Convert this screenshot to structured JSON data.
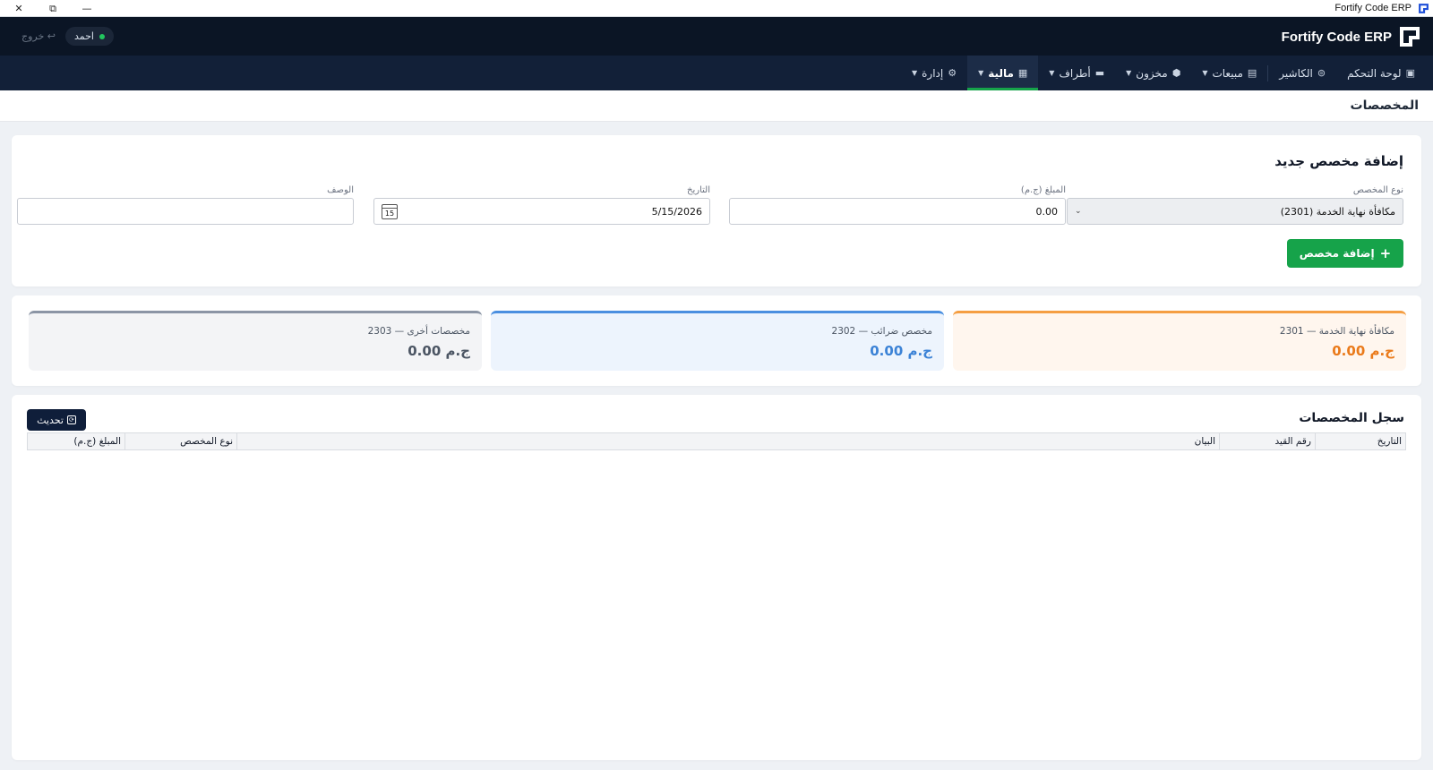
{
  "window": {
    "title": "Fortify Code ERP",
    "controls": {
      "close": "✕",
      "restore": "⧉",
      "minimize": "—"
    }
  },
  "header": {
    "brand": "Fortify Code ERP",
    "user": "احمد",
    "logout": "خروج ↩"
  },
  "nav": {
    "items": [
      {
        "label": "لوحة التحكم",
        "icon": "dashboard-icon",
        "caret": false,
        "active": false
      },
      {
        "label": "الكاشير",
        "icon": "cashier-icon",
        "caret": false,
        "active": false
      },
      {
        "label": "مبيعات",
        "icon": "receipt-icon",
        "caret": true,
        "active": false
      },
      {
        "label": "مخزون",
        "icon": "box-icon",
        "caret": true,
        "active": false
      },
      {
        "label": "أطراف",
        "icon": "people-icon",
        "caret": true,
        "active": false
      },
      {
        "label": "مالية",
        "icon": "finance-icon",
        "caret": true,
        "active": true
      },
      {
        "label": "إدارة",
        "icon": "gear-icon",
        "caret": true,
        "active": false
      }
    ]
  },
  "page": {
    "title": "المخصصات"
  },
  "form": {
    "title": "إضافة مخصص جديد",
    "type_label": "نوع المخصص",
    "type_value": "مكافأة نهاية الخدمة (2301)",
    "amount_label": "المبلغ (ج.م)",
    "amount_value": "0.00",
    "date_label": "التاريخ",
    "date_value": "5/15/2026",
    "calendar_day": "15",
    "desc_label": "الوصف",
    "desc_value": "",
    "add_button": "إضافة مخصص"
  },
  "stats": [
    {
      "label": "2301 — مكافأة نهاية الخدمة",
      "value": "0.00 ج.م",
      "color": "#ea7a1a"
    },
    {
      "label": "2302 — مخصص ضرائب",
      "value": "0.00 ج.م",
      "color": "#3b82d6"
    },
    {
      "label": "2303 — مخصصات أخرى",
      "value": "0.00 ج.م",
      "color": "#4b5563"
    }
  ],
  "table": {
    "title": "سجل المخصصات",
    "refresh_button": "تحديث",
    "columns": [
      "التاريخ",
      "رقم القيد",
      "البيان",
      "نوع المخصص",
      "المبلغ (ج.م)"
    ],
    "rows": []
  }
}
